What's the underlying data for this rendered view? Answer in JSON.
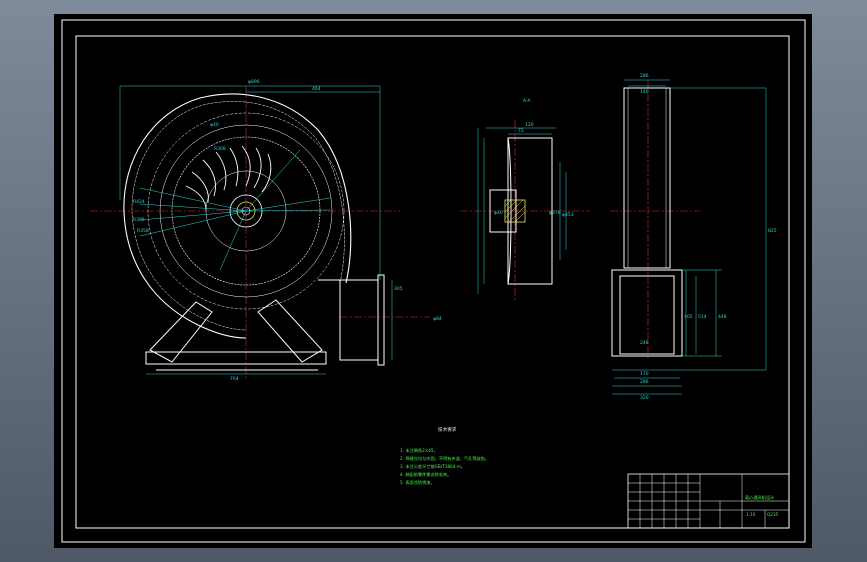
{
  "colors": {
    "background": "#000000",
    "frame": "#ffffff",
    "outline": "#ffffff",
    "dimension": "#2fd6d6",
    "centerline": "#e02828",
    "hatch": "#e8e85a",
    "notes": "#4cf04c"
  },
  "drawing": {
    "notes_title": "技术要求",
    "notes": [
      "1. 未注倒角2×45。",
      "2. 焊缝应均匀牢固，不得有夹渣、气孔等缺陷。",
      "3. 未注公差尺寸按GB/T1804-m。",
      "4. 装配前零件需去除毛刺。",
      "5. 表面涂防锈漆。"
    ],
    "title_block": {
      "drawing_title": "离心通风机设计",
      "scale_label": "1:10",
      "material_label": "Q235"
    },
    "front_view": {
      "dims": {
        "overall_width": "φ896",
        "half_width": "464",
        "bottom_width": "764",
        "outlet_height": "305",
        "outlet_label": "φ84",
        "radius_a": "R424",
        "radius_b": "R395",
        "radius_c": "R358",
        "radius_d": "R308",
        "impeller_label": "φ40"
      }
    },
    "section_view": {
      "dims": {
        "section_label": "A-A",
        "hub_top": "120",
        "hub_inner": "72",
        "shaft_dia": "φ40",
        "disk_dia": "φ376",
        "outer_dia": "φ453"
      }
    },
    "side_view": {
      "dims": {
        "top_width": "286",
        "inner_top": "140",
        "overall_height": "825",
        "base_width": "248",
        "base_inner": "170",
        "bottom_a": "286",
        "bottom_b": "320",
        "flange_a": "405",
        "flange_b": "514",
        "flange_c": "448"
      }
    }
  }
}
